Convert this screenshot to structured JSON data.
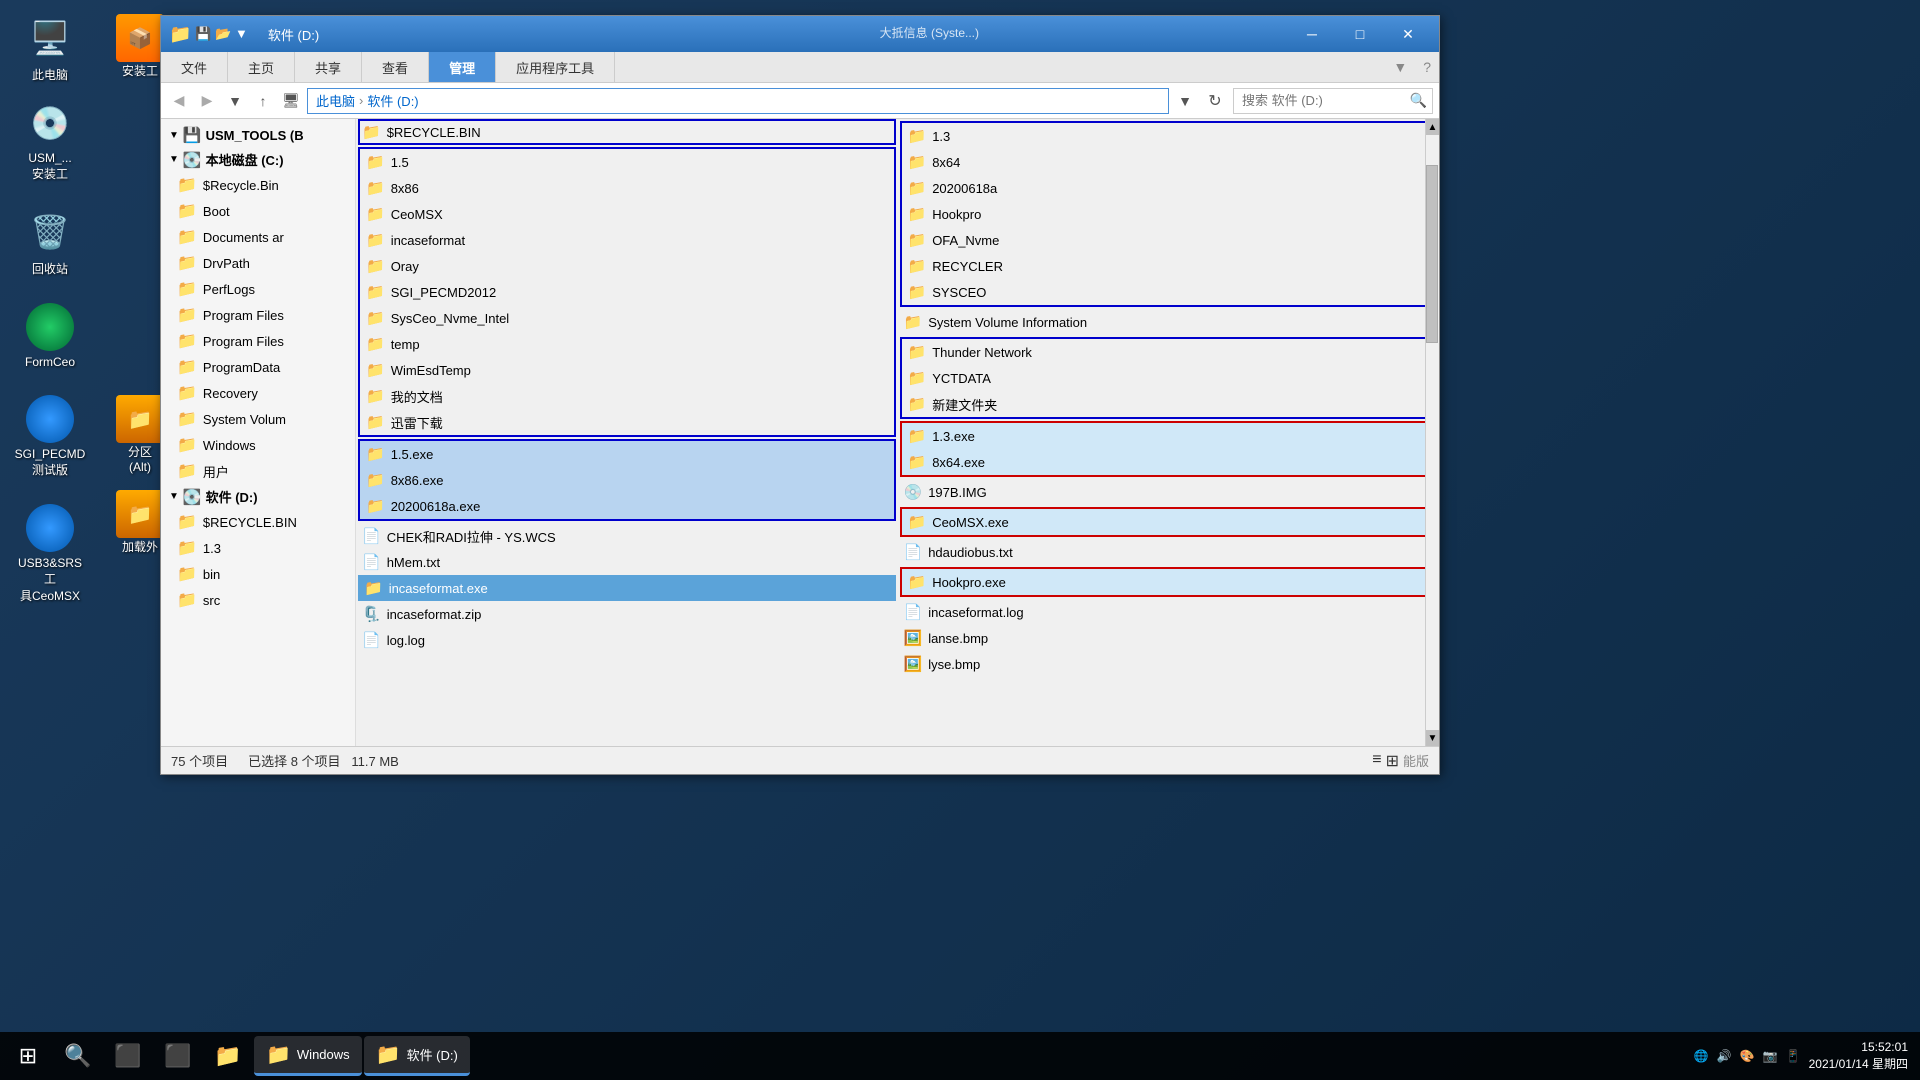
{
  "desktop": {
    "icons": [
      {
        "id": "computer",
        "label": "此电脑",
        "emoji": "🖥️"
      },
      {
        "id": "usm",
        "label": "USM_...\n安装工",
        "emoji": "💾"
      },
      {
        "id": "recycle",
        "label": "回收站",
        "emoji": "🗑️"
      },
      {
        "id": "formceo",
        "label": "FormCeo",
        "emoji": "🔵"
      },
      {
        "id": "sgi_pecmd",
        "label": "SGI_PECMD\n测试版",
        "emoji": "🔵"
      },
      {
        "id": "usb3srs",
        "label": "USB3&SRS工\n具CeoMSX",
        "emoji": "🔵"
      }
    ]
  },
  "window": {
    "title": "软件 (D:)",
    "titlebar_left_icons": [
      "📁",
      "💾",
      "📂"
    ],
    "tabs": [
      "文件",
      "主页",
      "共享",
      "查看",
      "应用程序工具"
    ],
    "manage_tab": "管理",
    "address_path": "此电脑 > 软件 (D:)",
    "search_placeholder": "搜索 软件 (D:)"
  },
  "sidebar": {
    "items": [
      {
        "label": "USM_TOOLS (B",
        "type": "drive",
        "arrow": "▼"
      },
      {
        "label": "本地磁盘 (C:)",
        "type": "drive",
        "arrow": "▼"
      },
      {
        "label": "$Recycle.Bin",
        "indent": 1
      },
      {
        "label": "Boot",
        "indent": 1
      },
      {
        "label": "Documents ar",
        "indent": 1
      },
      {
        "label": "DrvPath",
        "indent": 1
      },
      {
        "label": "PerfLogs",
        "indent": 1
      },
      {
        "label": "Program Files",
        "indent": 1
      },
      {
        "label": "Program Files",
        "indent": 1
      },
      {
        "label": "ProgramData",
        "indent": 1
      },
      {
        "label": "Recovery",
        "indent": 1
      },
      {
        "label": "System Volum",
        "indent": 1
      },
      {
        "label": "Windows",
        "indent": 1
      },
      {
        "label": "用户",
        "indent": 1
      },
      {
        "label": "软件 (D:)",
        "type": "drive",
        "arrow": "▼",
        "selected": true
      },
      {
        "label": "$RECYCLE.BIN",
        "indent": 1
      },
      {
        "label": "1.3",
        "indent": 1
      },
      {
        "label": "bin",
        "indent": 1
      },
      {
        "label": "src",
        "indent": 1
      }
    ]
  },
  "files": {
    "left_col": [
      {
        "name": "$RECYCLE.BIN",
        "type": "folder",
        "selected": "outline-blue"
      },
      {
        "name": "1.5",
        "type": "folder",
        "selected": "outline-blue"
      },
      {
        "name": "8x86",
        "type": "folder"
      },
      {
        "name": "CeoMSX",
        "type": "folder"
      },
      {
        "name": "incaseformat",
        "type": "folder"
      },
      {
        "name": "Oray",
        "type": "folder"
      },
      {
        "name": "SGI_PECMD2012",
        "type": "folder"
      },
      {
        "name": "SysCeo_Nvme_Intel",
        "type": "folder"
      },
      {
        "name": "temp",
        "type": "folder"
      },
      {
        "name": "WimEsdTemp",
        "type": "folder"
      },
      {
        "name": "我的文档",
        "type": "folder"
      },
      {
        "name": "迅雷下载",
        "type": "folder"
      },
      {
        "name": "1.5.exe",
        "type": "exe",
        "selected": "outline-blue-bg"
      },
      {
        "name": "8x86.exe",
        "type": "exe",
        "selected": "outline-blue-bg"
      },
      {
        "name": "20200618a.exe",
        "type": "exe",
        "selected": "outline-blue-bg"
      },
      {
        "name": "CHEK和RADI拉伸 - YS.WCS",
        "type": "file"
      },
      {
        "name": "hMem.txt",
        "type": "txt"
      },
      {
        "name": "incaseformat.exe",
        "type": "exe",
        "selected": "dark-blue"
      },
      {
        "name": "incaseformat.zip",
        "type": "zip"
      },
      {
        "name": "log.log",
        "type": "file"
      }
    ],
    "right_col": [
      {
        "name": "1.3",
        "type": "folder",
        "selected": "outline-blue"
      },
      {
        "name": "8x64",
        "type": "folder"
      },
      {
        "name": "20200618a",
        "type": "folder"
      },
      {
        "name": "Hookpro",
        "type": "folder"
      },
      {
        "name": "OFA_Nvme",
        "type": "folder"
      },
      {
        "name": "RECYCLER",
        "type": "folder"
      },
      {
        "name": "SYSCEO",
        "type": "folder"
      },
      {
        "name": "System Volume Information",
        "type": "folder",
        "special": true
      },
      {
        "name": "Thunder Network",
        "type": "folder",
        "selected": "outline-blue"
      },
      {
        "name": "YCTDATA",
        "type": "folder"
      },
      {
        "name": "新建文件夹",
        "type": "folder"
      },
      {
        "name": "1.3.exe",
        "type": "exe",
        "selected": "outline-red-bg"
      },
      {
        "name": "8x64.exe",
        "type": "exe",
        "selected": "outline-red-bg"
      },
      {
        "name": "197B.IMG",
        "type": "img"
      },
      {
        "name": "CeoMSX.exe",
        "type": "exe",
        "selected": "outline-red"
      },
      {
        "name": "hdaudiobus.txt",
        "type": "txt"
      },
      {
        "name": "Hookpro.exe",
        "type": "exe",
        "selected": "outline-red-bg"
      },
      {
        "name": "incaseformat.log",
        "type": "log"
      },
      {
        "name": "lanse.bmp",
        "type": "bmp"
      },
      {
        "name": "lyse.bmp",
        "type": "bmp"
      }
    ]
  },
  "status": {
    "total": "75 个项目",
    "selected": "已选择 8 个项目",
    "size": "11.7 MB"
  },
  "taskbar": {
    "items": [
      {
        "label": "Windows",
        "emoji": "⊞"
      },
      {
        "label": "Search",
        "emoji": "🔍"
      },
      {
        "label": "CMD",
        "emoji": "⬛"
      },
      {
        "label": "Explorer",
        "emoji": "📁"
      },
      {
        "label": "软件 (D:)",
        "emoji": "📁",
        "active": true
      }
    ],
    "tray": {
      "time": "15:52:01",
      "date": "2021/01/14 星期四"
    }
  }
}
